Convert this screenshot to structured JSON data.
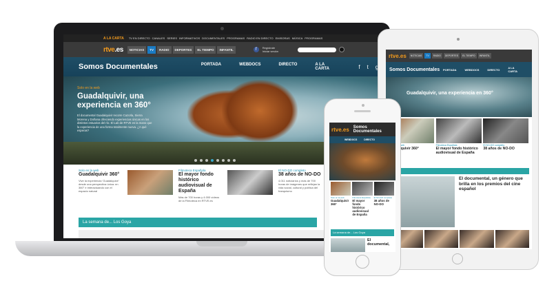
{
  "laptop": {
    "topbar": {
      "a_la_carta": "A la carta",
      "items": [
        "TV en directo",
        "Canales",
        "Series",
        "Informativos",
        "Documentales",
        "Programas",
        "Radio en directo",
        "Emisoras",
        "Música",
        "Programas"
      ]
    },
    "nav": {
      "logo_a": "rtve",
      "logo_b": ".es",
      "tabs": [
        "Noticias",
        "TV",
        "Radio",
        "Deportes",
        "El tiempo",
        "Infantil"
      ],
      "register_1": "Regístrate",
      "register_2": "Iniciar sesión"
    },
    "section": {
      "title": "Somos Documentales",
      "nav": [
        "PORTADA",
        "WEBDOCS",
        "DIRECTO",
        "A LA CARTA"
      ],
      "icons": [
        "f",
        "t",
        "g+"
      ]
    },
    "hero": {
      "kicker": "Solo en la web",
      "title": "Guadalquivir, una experiencia en 360°",
      "desc": "El documental Guadalquivir recorre Cazorla, Sierra Morena y Doñana ofreciendo experiencias únicas en los distintos estuarios del río. El Lab de RTVE es la mano que la experiencia de una forma totalmente nueva. ¿A qué esperas?"
    },
    "cards": [
      {
        "kicker": "Solo en la web",
        "title": "Guadalquivir 360°",
        "desc": "Vive la experiencia 'Guadalquivir' desde una perspectiva única: en 360° e interactuando con el espacio natural"
      },
      {
        "kicker": "Filmoteca Española",
        "title": "El mayor fondo histórico audiovisual de España",
        "desc": "Más de 700 horas y 4.000 vídeos de la Filmoteca en RTVE.es"
      },
      {
        "kicker": "El NO-DO completo",
        "title": "38 años de NO-DO",
        "desc": "4.011 noticiarios y más de 700 horas de imágenes que reflejan la vida social, cultural y política del franquismo"
      }
    ],
    "semana": "La semana de... Los Goya"
  },
  "ipad": {
    "logo": "rtve.es",
    "tabs": [
      "Noticias",
      "TV",
      "Radio",
      "Deportes",
      "El tiempo",
      "Infantil"
    ],
    "section_title": "Somos Documentales",
    "nav": [
      "PORTADA",
      "WEBDOCS",
      "DIRECTO",
      "A LA CARTA"
    ],
    "hero_title": "Guadalquivir, una experiencia en 360°",
    "cards": [
      {
        "kicker": "Solo en la web",
        "title": "Guadalquivir 360°"
      },
      {
        "kicker": "Filmoteca Española",
        "title": "El mayor fondo histórico audiovisual de España"
      },
      {
        "kicker": "El NO-DO completo",
        "title": "38 años de NO-DO"
      }
    ],
    "doc_title": "El documental, un género que brilla en los premios del cine español"
  },
  "iphone": {
    "logo": "rtve.es",
    "section_title": "Somos Documentales",
    "nav": [
      "WEBDOCS",
      "DIRECTO"
    ],
    "cards": [
      {
        "kicker": "Solo en la web",
        "title": "Guadalquivir 360°"
      },
      {
        "kicker": "Filmoteca Española",
        "title": "El mayor fondo histórico audiovisual de España"
      },
      {
        "kicker": "El NO-DO completo",
        "title": "38 años de NO-DO"
      }
    ],
    "semana": "La semana de... Los Goya",
    "doc_title": "El documental,"
  }
}
